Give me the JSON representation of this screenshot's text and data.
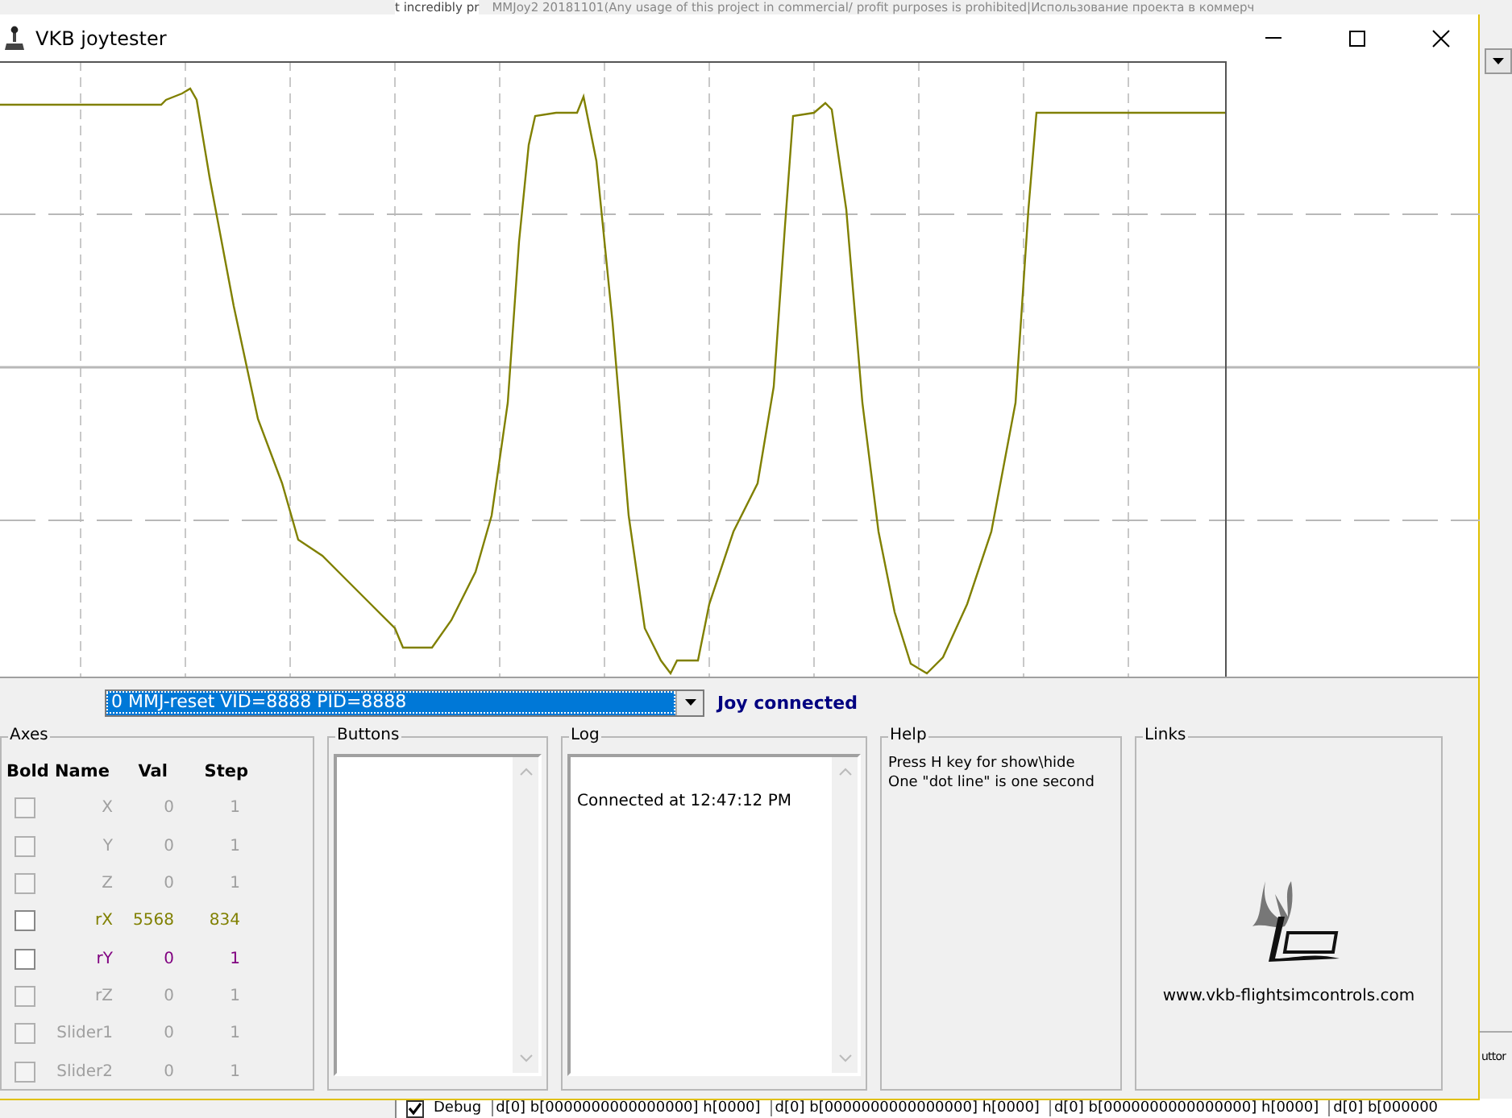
{
  "background_window": {
    "title": "MMJoy2 20181101(Any usage of this project in commercial/ profit purposes is prohibited|Использование проекта в коммерч",
    "left_text": "t incredibly pr",
    "side_label": "uttor",
    "debug_checked": true,
    "debug_label": "Debug",
    "debug_cells": [
      "d[0] b[0000000000000000] h[0000]",
      "d[0] b[0000000000000000] h[0000]",
      "d[0] b[0000000000000000] h[0000]",
      "d[0] b[000000"
    ]
  },
  "window": {
    "title": "VKB joytester"
  },
  "device": {
    "value": "0 MMJ-reset VID=8888 PID=8888",
    "status": "Joy connected"
  },
  "axes": {
    "title": "Axes",
    "columns": [
      "Bold",
      "Name",
      "Val",
      "Step"
    ],
    "rows": [
      {
        "name": "X",
        "val": "0",
        "step": "1",
        "checked": false,
        "disabled": true,
        "color": "#a0a0a0"
      },
      {
        "name": "Y",
        "val": "0",
        "step": "1",
        "checked": false,
        "disabled": true,
        "color": "#a0a0a0"
      },
      {
        "name": "Z",
        "val": "0",
        "step": "1",
        "checked": false,
        "disabled": true,
        "color": "#a0a0a0"
      },
      {
        "name": "rX",
        "val": "5568",
        "step": "834",
        "checked": false,
        "disabled": false,
        "color": "#808000"
      },
      {
        "name": "rY",
        "val": "0",
        "step": "1",
        "checked": false,
        "disabled": false,
        "color": "#800080"
      },
      {
        "name": "rZ",
        "val": "0",
        "step": "1",
        "checked": false,
        "disabled": true,
        "color": "#a0a0a0"
      },
      {
        "name": "Slider1",
        "val": "0",
        "step": "1",
        "checked": false,
        "disabled": true,
        "color": "#a0a0a0"
      },
      {
        "name": "Slider2",
        "val": "0",
        "step": "1",
        "checked": false,
        "disabled": true,
        "color": "#a0a0a0"
      }
    ]
  },
  "buttons": {
    "title": "Buttons"
  },
  "log": {
    "title": "Log",
    "lines": [
      "Connected at 12:47:12 PM"
    ]
  },
  "help": {
    "title": "Help",
    "lines": [
      "Press H key for show\\hide",
      "One \"dot line\" is one second"
    ]
  },
  "links": {
    "title": "Links",
    "url": "www.vkb-flightsimcontrols.com"
  }
}
